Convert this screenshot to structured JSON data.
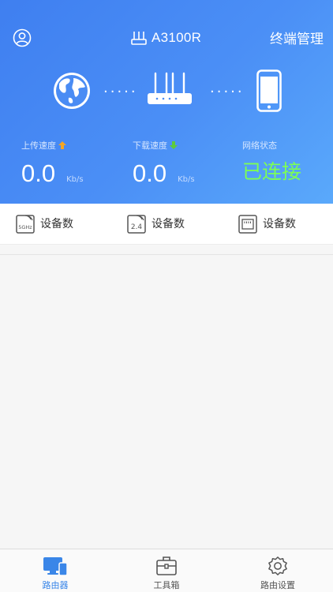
{
  "header": {
    "router_name": "A3100R",
    "terminal_label": "终端管理"
  },
  "icons": {
    "account": "account-icon",
    "router_small": "router-icon",
    "globe": "globe-icon",
    "router": "router-icon",
    "phone": "phone-icon",
    "up_arrow": "arrow-up-icon",
    "down_arrow": "arrow-down-icon"
  },
  "stats": {
    "upload": {
      "label": "上传速度",
      "value": "0.0",
      "unit": "Kb/s"
    },
    "download": {
      "label": "下载速度",
      "value": "0.0",
      "unit": "Kb/s"
    },
    "network": {
      "label": "网络状态",
      "value": "已连接"
    }
  },
  "devices": [
    {
      "badge": "5GHz",
      "label": "设备数"
    },
    {
      "badge": "2.4",
      "label": "设备数"
    },
    {
      "badge": "LAN",
      "label": "设备数"
    }
  ],
  "tabs": [
    {
      "label": "路由器",
      "active": true
    },
    {
      "label": "工具箱",
      "active": false
    },
    {
      "label": "路由设置",
      "active": false
    }
  ],
  "colors": {
    "header_gradient_start": "#3f7ff0",
    "header_gradient_end": "#5aa9fb",
    "status_connected": "#7cff55",
    "upload_arrow": "#f5a623",
    "download_arrow": "#5ecb3a",
    "tab_active": "#3a86e8"
  }
}
